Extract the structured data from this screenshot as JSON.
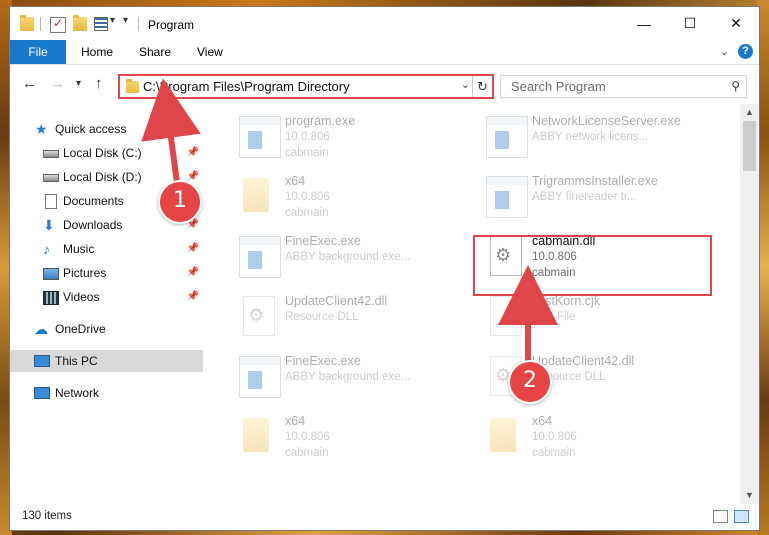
{
  "window": {
    "title": "Program"
  },
  "ribbon": {
    "tabs": [
      "File",
      "Home",
      "Share",
      "View"
    ],
    "help": "?"
  },
  "address": {
    "path": "C:\\Program Files\\Program Directory"
  },
  "search": {
    "placeholder": "Search Program"
  },
  "sidebar": {
    "items": [
      {
        "label": "Quick access",
        "icon": "star-icon"
      },
      {
        "label": "Local Disk (C:)",
        "icon": "disk-icon",
        "pinned": true
      },
      {
        "label": "Local Disk (D:)",
        "icon": "disk-icon",
        "pinned": true
      },
      {
        "label": "Documents",
        "icon": "document-icon",
        "pinned": true
      },
      {
        "label": "Downloads",
        "icon": "download-icon",
        "pinned": true
      },
      {
        "label": "Music",
        "icon": "music-icon",
        "pinned": true
      },
      {
        "label": "Pictures",
        "icon": "picture-icon",
        "pinned": true
      },
      {
        "label": "Videos",
        "icon": "video-icon",
        "pinned": true
      },
      {
        "label": "OneDrive",
        "icon": "cloud-icon"
      },
      {
        "label": "This PC",
        "icon": "computer-icon",
        "selected": true
      },
      {
        "label": "Network",
        "icon": "network-icon"
      }
    ]
  },
  "files": [
    {
      "name": "program.exe",
      "line1": "10.0.806",
      "line2": "cabmain",
      "kind": "exe"
    },
    {
      "name": "NetworkLicenseServer.exe",
      "line1": "ABBY network licens...",
      "line2": "",
      "kind": "exe"
    },
    {
      "name": "x64",
      "line1": "10.0.806",
      "line2": "cabmain",
      "kind": "folder"
    },
    {
      "name": "TrigrammsInstaller.exe",
      "line1": "ABBY finereader tr...",
      "line2": "",
      "kind": "exe"
    },
    {
      "name": "FineExec.exe",
      "line1": "ABBY background exe...",
      "line2": "",
      "kind": "exe"
    },
    {
      "name": "cabmain.dll",
      "line1": "10.0.806",
      "line2": "cabmain",
      "kind": "dll",
      "highlighted": true
    },
    {
      "name": "UpdateClient42.dll",
      "line1": "Resource DLL",
      "line2": "",
      "kind": "dll"
    },
    {
      "name": "TestKorn.cjk",
      "line1": "CJK File",
      "line2": "",
      "kind": "blank"
    },
    {
      "name": "FineExec.exe",
      "line1": "ABBY background exe...",
      "line2": "",
      "kind": "exe"
    },
    {
      "name": "UpdateClient42.dll",
      "line1": "Resource DLL",
      "line2": "",
      "kind": "dll"
    },
    {
      "name": "x64",
      "line1": "10.0.806",
      "line2": "cabmain",
      "kind": "folder"
    },
    {
      "name": "x64",
      "line1": "10.0.806",
      "line2": "cabmain",
      "kind": "folder"
    }
  ],
  "status": {
    "item_count": "130 items"
  },
  "annotations": {
    "marker1": "1",
    "marker2": "2",
    "accent": "#e0454a"
  }
}
